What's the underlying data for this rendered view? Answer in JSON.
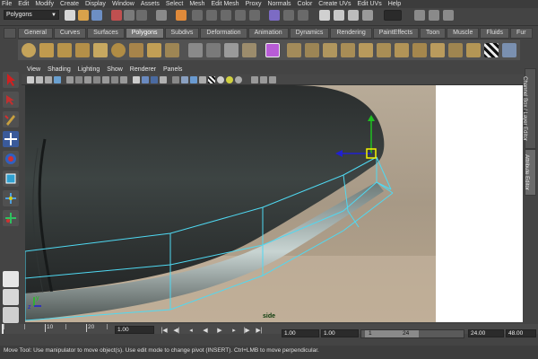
{
  "menubar": [
    "File",
    "Edit",
    "Modify",
    "Create",
    "Display",
    "Window",
    "Assets",
    "Select",
    "Mesh",
    "Edit Mesh",
    "Proxy",
    "Normals",
    "Color",
    "Create UVs",
    "Edit UVs",
    "Help"
  ],
  "status_line": {
    "mode": "Polygons"
  },
  "shelf": {
    "tabs": [
      "General",
      "Curves",
      "Surfaces",
      "Polygons",
      "Subdivs",
      "Deformation",
      "Animation",
      "Dynamics",
      "Rendering",
      "PaintEffects",
      "Toon",
      "Muscle",
      "Fluids",
      "Fur"
    ],
    "active_tab": "Polygons"
  },
  "panel": {
    "menu": [
      "View",
      "Shading",
      "Lighting",
      "Show",
      "Renderer",
      "Panels"
    ],
    "camera_label": "side",
    "axis_labels": [
      "z",
      "y"
    ]
  },
  "right_tabs": {
    "channel_box": "Channel Box / Layer Editor",
    "attribute_editor": "Attribute Editor"
  },
  "time_slider": {
    "tick_labels": [
      "10",
      "20"
    ],
    "current_frame": "1.00"
  },
  "range_slider": {
    "start_time": "1.00",
    "playback_start": "1.00",
    "range_start_label": "1",
    "range_end_label": "24",
    "playback_end": "24.00",
    "end_time": "48.00"
  },
  "help_line": "Move Tool: Use manipulator to move object(s). Use edit mode to change pivot (INSERT). Ctrl+LMB to move perpendicular.",
  "colors": {
    "accent_active_tab": "#777777",
    "wireframe": "#4fd9f2",
    "manipulator_x": "#2020d0",
    "manipulator_y": "#20c020",
    "manipulator_center": "#f5f500"
  }
}
